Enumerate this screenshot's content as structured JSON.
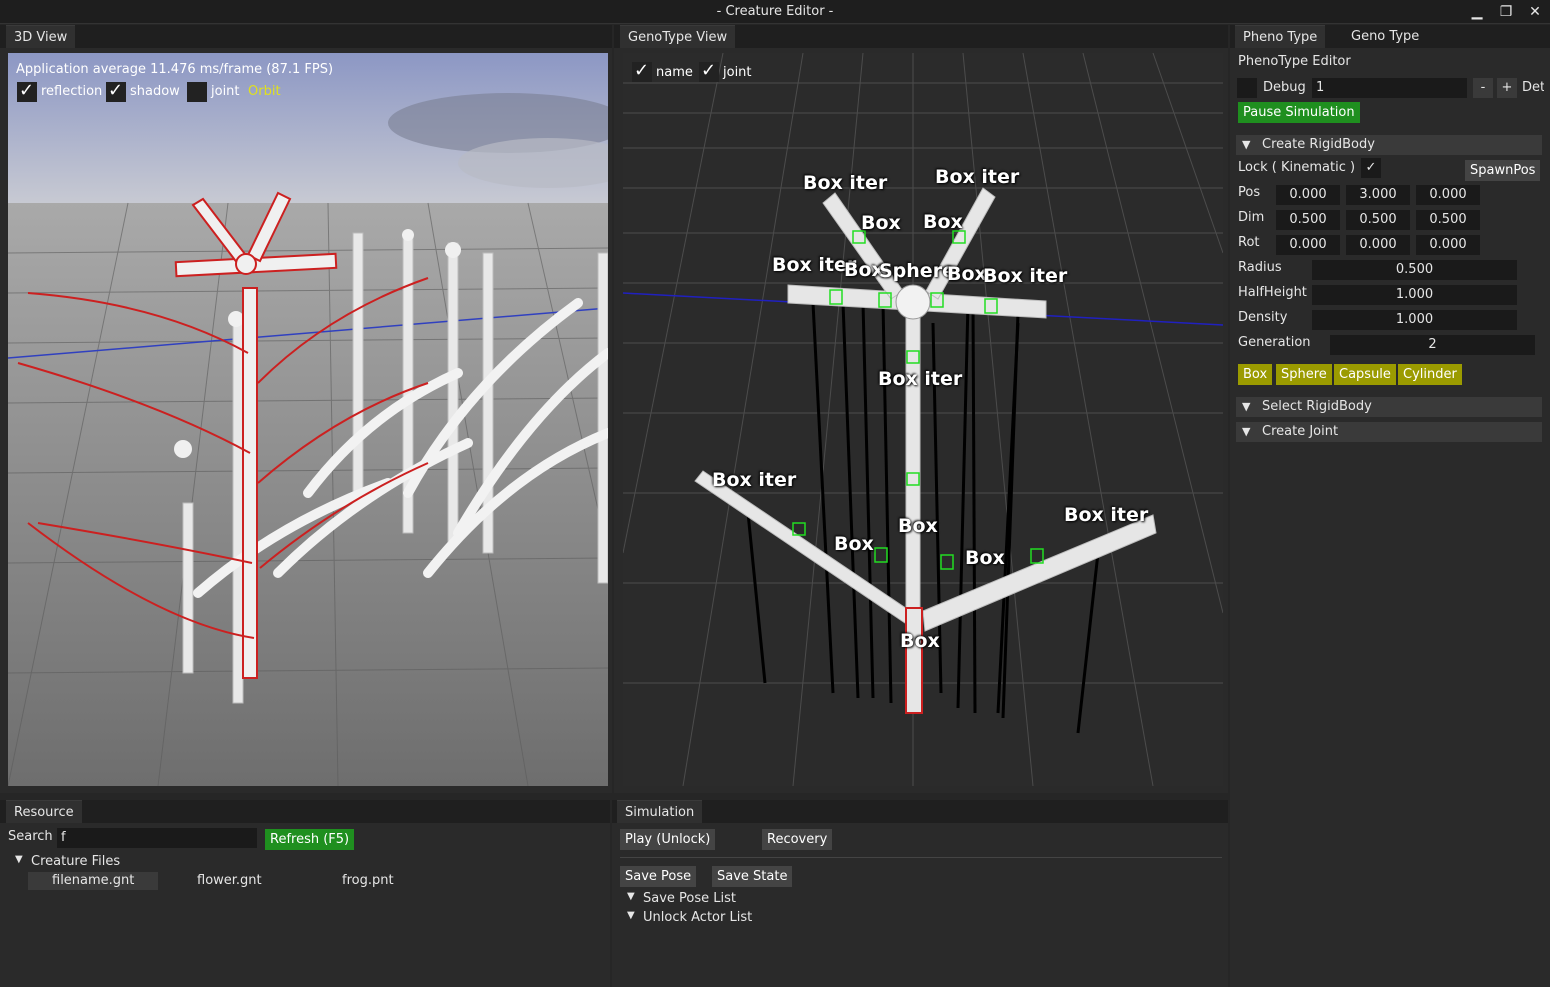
{
  "window": {
    "title": "- Creature Editor -",
    "minimize": "▁",
    "maximize": "❐",
    "close": "✕"
  },
  "view3d": {
    "tab": "3D View",
    "fps_text": "Application average 11.476 ms/frame (87.1 FPS)",
    "reflection_label": "reflection",
    "shadow_label": "shadow",
    "joint_label": "joint",
    "orbit_label": "Orbit",
    "reflection_checked": true,
    "shadow_checked": true,
    "joint_checked": false
  },
  "genotype": {
    "tab": "GenoType View",
    "name_label": "name",
    "joint_label": "joint",
    "labels": {
      "l1": "Box iter",
      "l2": "Box iter",
      "l3": "Box",
      "l4": "Box",
      "l5": "Box iter",
      "l6": "Box",
      "l7": "Sphere",
      "l8": "Box",
      "l9": "Box iter",
      "l10": "Box iter",
      "l11": "Box iter",
      "l12": "Box",
      "l13": "Box",
      "l14": "Box iter",
      "l15": "Box",
      "l16": "Box"
    }
  },
  "right": {
    "tab_pheno": "Pheno Type",
    "tab_geno": "Geno Type",
    "editor_title": "PhenoType Editor",
    "debug_label": "Debug",
    "debug_value": "1",
    "minus": "-",
    "plus": "+",
    "det_label": "Det",
    "pause_button": "Pause Simulation",
    "create_rigidbody": "Create RigidBody",
    "lock_label": "Lock ( Kinematic )",
    "spawnpos": "SpawnPos",
    "pos_label": "Pos",
    "pos": [
      "0.000",
      "3.000",
      "0.000"
    ],
    "dim_label": "Dim",
    "dim": [
      "0.500",
      "0.500",
      "0.500"
    ],
    "rot_label": "Rot",
    "rot": [
      "0.000",
      "0.000",
      "0.000"
    ],
    "radius_label": "Radius",
    "radius": "0.500",
    "halfheight_label": "HalfHeight",
    "halfheight": "1.000",
    "density_label": "Density",
    "density": "1.000",
    "generation_label": "Generation",
    "generation": "2",
    "shape_buttons": [
      "Box",
      "Sphere",
      "Capsule",
      "Cylinder"
    ],
    "select_rigidbody": "Select RigidBody",
    "create_joint": "Create Joint"
  },
  "resource": {
    "tab": "Resource",
    "search_label": "Search",
    "search_value": "f",
    "refresh": "Refresh (F5)",
    "tree_root": "Creature Files",
    "files": [
      "filename.gnt",
      "flower.gnt",
      "frog.pnt"
    ]
  },
  "simulation": {
    "tab": "Simulation",
    "play": "Play (Unlock)",
    "recovery": "Recovery",
    "save_pose": "Save Pose",
    "save_state": "Save State",
    "save_pose_list": "Save Pose List",
    "unlock_actor_list": "Unlock Actor List"
  },
  "colors": {
    "accent_green": "#1f8f1f",
    "olive": "#9b9b00",
    "orbit_yellow": "#e0e020",
    "selection_red": "#cc2020"
  }
}
